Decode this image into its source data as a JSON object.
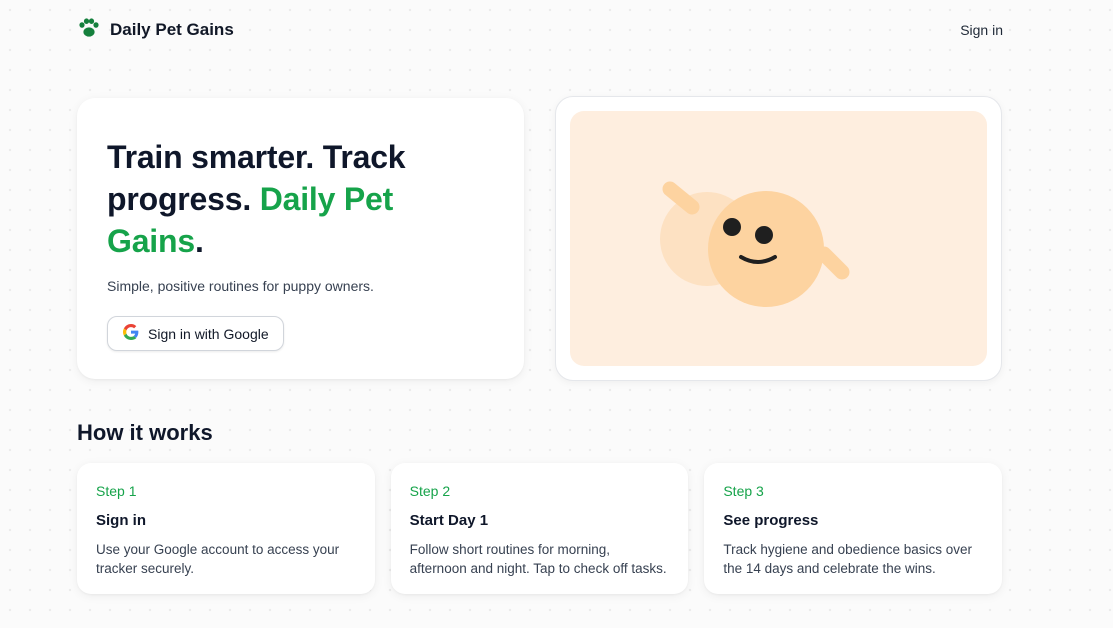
{
  "header": {
    "brand": "Daily Pet Gains",
    "logo_icon": "paw-icon",
    "signin_link": "Sign in"
  },
  "hero": {
    "title_part1": "Train smarter. Track progress. ",
    "title_accent": "Daily Pet Gains",
    "title_end": ".",
    "subtitle": "Simple, positive routines for puppy owners.",
    "google_button": "Sign in with Google",
    "google_icon": "google-g-icon"
  },
  "illustration": {
    "icon": "puppy-face-illustration"
  },
  "how_it_works": {
    "title": "How it works",
    "steps": [
      {
        "label": "Step 1",
        "title": "Sign in",
        "description": "Use your Google account to access your tracker securely."
      },
      {
        "label": "Step 2",
        "title": "Start Day 1",
        "description": "Follow short routines for morning, afternoon and night. Tap to check off tasks."
      },
      {
        "label": "Step 3",
        "title": "See progress",
        "description": "Track hygiene and obedience basics over the 14 days and celebrate the wins."
      }
    ]
  },
  "colors": {
    "accent": "#16a34a",
    "illustration_bg": "#feeedf",
    "puppy_face": "#fdd3a0"
  }
}
